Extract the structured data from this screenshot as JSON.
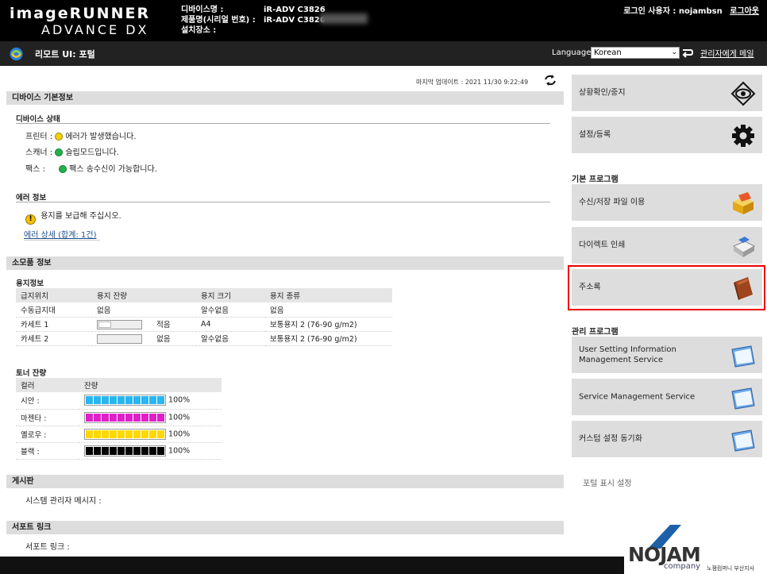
{
  "header": {
    "brand_line1": "imageRUNNER",
    "brand_line2": "ADVANCE DX",
    "device_name_label": "디바이스명 :",
    "device_name": "iR-ADV C3826",
    "product_label": "제품명(시리얼 번호) :",
    "product_name": "iR-ADV C3826",
    "location_label": "설치장소 :",
    "location": "",
    "login_user_label": "로그인 사용자 :",
    "login_user": "nojambsn",
    "logout": "로그아웃"
  },
  "titlebar": {
    "title": "리모트 UI: 포털",
    "language_label": "Language:",
    "language_value": "Korean",
    "mail_admin": "관리자에게 메일"
  },
  "main": {
    "last_update": "마지막 업데이트 : 2021 11/30 9:22:49",
    "device_basic_info": "디바이스 기본정보",
    "device_status": "디바이스 상태",
    "status": [
      {
        "label": "프린터 :",
        "color": "#f5d000",
        "text": "에러가 발생했습니다."
      },
      {
        "label": "스캐너 :",
        "color": "#22b14c",
        "text": "슬립모드입니다."
      },
      {
        "label": "팩스 :",
        "color": "#22b14c",
        "text": "팩스 송수신이 가능합니다."
      }
    ],
    "error_info": "에러 정보",
    "error_message": "용지를 보급해 주십시오.",
    "error_detail_link": "에러 상세 (합계: 1건)",
    "consumables": "소모품 정보",
    "paper_info": "용지정보",
    "paper_headers": [
      "급지위치",
      "용지 잔량",
      "용지 크기",
      "용지 종류"
    ],
    "paper_rows": [
      {
        "source": "수동급지대",
        "remain_text": "없음",
        "gauge": false,
        "size": "알수없음",
        "type": "없음"
      },
      {
        "source": "카세트 1",
        "remain_text": "적음",
        "gauge": true,
        "level": 0.3,
        "size": "A4",
        "type": "보통용지 2 (76-90 g/m2)"
      },
      {
        "source": "카세트 2",
        "remain_text": "없음",
        "gauge": true,
        "level": 0,
        "size": "알수없음",
        "type": "보통용지 2 (76-90 g/m2)"
      }
    ],
    "toner_title": "토너 잔량",
    "toner_headers": [
      "컬러",
      "잔량"
    ],
    "toner_rows": [
      {
        "color_name": "시안 :",
        "color": "#29b6f0",
        "percent": "100%",
        "level": 1.0
      },
      {
        "color_name": "마젠타 :",
        "color": "#e020c8",
        "percent": "100%",
        "level": 1.0
      },
      {
        "color_name": "옐로우 :",
        "color": "#ffd800",
        "percent": "100%",
        "level": 1.0
      },
      {
        "color_name": "블랙 :",
        "color": "#000000",
        "percent": "100%",
        "level": 1.0
      }
    ],
    "bulletin": "게시판",
    "sysadmin_message": "시스템 관리자 메시지 :",
    "support_links": "서포트 링크",
    "support_link_label": "서포트 링크 :"
  },
  "right": {
    "status_monitor": "상황확인/중지",
    "settings": "설정/등록",
    "basic_programs": "기본 프로그램",
    "receive_files": "수신/저장 파일 이용",
    "direct_print": "다이렉트 인쇄",
    "address_book": "주소록",
    "mgmt_programs": "관리 프로그램",
    "user_setting_service": "User Setting Information Management Service",
    "service_mgmt": "Service Management Service",
    "custom_sync": "커스텀 설정 동기화",
    "portal_display": "포털 표시 설정"
  },
  "watermark": {
    "brand": "NOJAM",
    "company": "company",
    "branch": "노잼컴퍼니 부산지사"
  }
}
